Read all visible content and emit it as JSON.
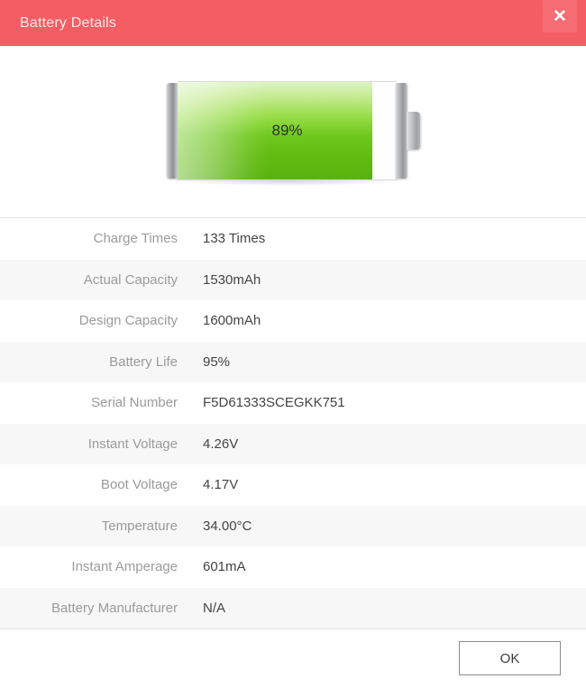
{
  "window": {
    "title": "Battery Details",
    "accent_color": "#f45d63",
    "close_icon": "close-icon"
  },
  "battery": {
    "percent_label": "89%",
    "percent_value": 89,
    "fill_color": "#6ec81d"
  },
  "details": {
    "rows": [
      {
        "label": "Charge Times",
        "value": "133 Times"
      },
      {
        "label": "Actual Capacity",
        "value": "1530mAh"
      },
      {
        "label": "Design Capacity",
        "value": "1600mAh"
      },
      {
        "label": "Battery Life",
        "value": "95%"
      },
      {
        "label": "Serial Number",
        "value": "F5D61333SCEGKK751"
      },
      {
        "label": "Instant Voltage",
        "value": "4.26V"
      },
      {
        "label": "Boot Voltage",
        "value": "4.17V"
      },
      {
        "label": "Temperature",
        "value": "34.00°C"
      },
      {
        "label": "Instant Amperage",
        "value": "601mA"
      },
      {
        "label": "Battery Manufacturer",
        "value": "N/A"
      }
    ]
  },
  "footer": {
    "ok_label": "OK"
  }
}
